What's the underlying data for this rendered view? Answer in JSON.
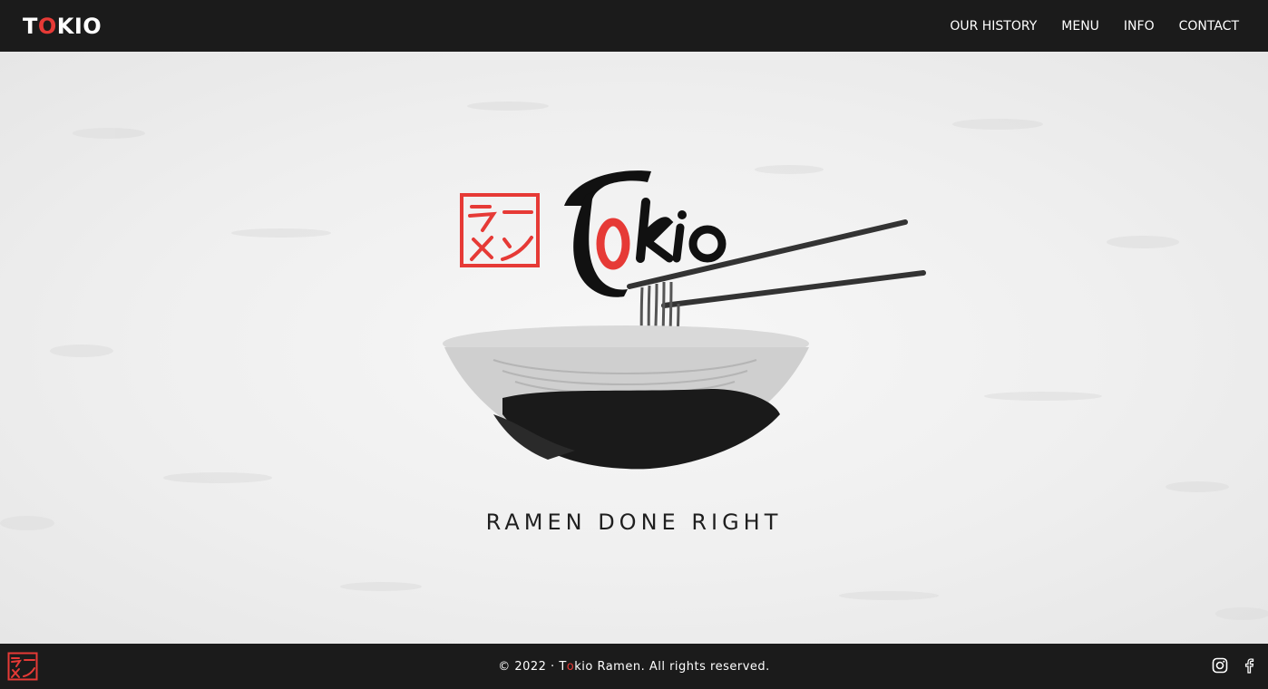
{
  "header": {
    "brand_pre": "T",
    "brand_o": "O",
    "brand_post": "KIO",
    "nav": [
      {
        "label": "OUR HISTORY"
      },
      {
        "label": "MENU"
      },
      {
        "label": "INFO"
      },
      {
        "label": "CONTACT"
      }
    ]
  },
  "hero": {
    "logo_pre": "T",
    "logo_o": "o",
    "logo_post": "kio",
    "stamp_text": "ラーメン",
    "tagline": "RAMEN DONE RIGHT"
  },
  "footer": {
    "copyright_pre": "© 2022 · T",
    "copyright_o": "o",
    "copyright_post": "kio Ramen. All rights reserved.",
    "social_icons": [
      "instagram-icon",
      "facebook-icon"
    ]
  },
  "colors": {
    "accent": "#e63a36",
    "bar": "#1b1b1b",
    "paper": "#efefef"
  }
}
